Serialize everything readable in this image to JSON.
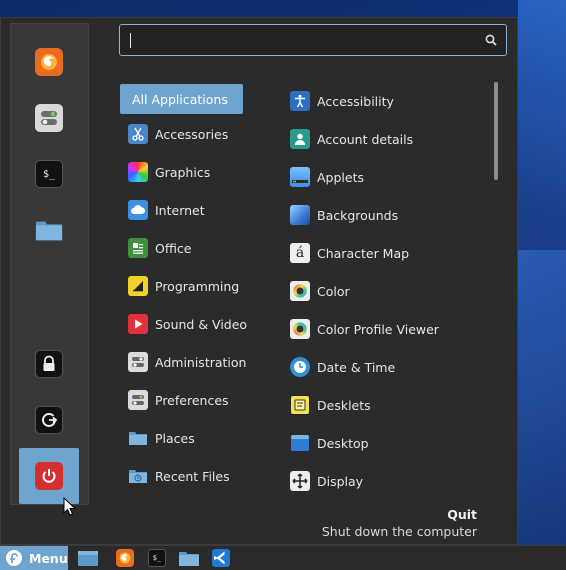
{
  "search": {
    "value": "",
    "placeholder": ""
  },
  "sidebar": {
    "favorites": [
      {
        "name": "firefox",
        "icon": "firefox-icon"
      },
      {
        "name": "settings",
        "icon": "toggle-settings-icon"
      },
      {
        "name": "terminal",
        "icon": "terminal-icon",
        "glyph": "$_"
      },
      {
        "name": "files",
        "icon": "folder-icon"
      }
    ],
    "session": [
      {
        "name": "lock-screen",
        "icon": "lock-icon"
      },
      {
        "name": "logout",
        "icon": "logout-icon"
      },
      {
        "name": "quit",
        "icon": "power-icon",
        "active": true
      }
    ]
  },
  "categories": [
    {
      "label": "All Applications",
      "selected": true
    },
    {
      "label": "Accessories",
      "icon": "scissors-icon"
    },
    {
      "label": "Graphics",
      "icon": "graphics-icon"
    },
    {
      "label": "Internet",
      "icon": "cloud-icon"
    },
    {
      "label": "Office",
      "icon": "office-icon"
    },
    {
      "label": "Programming",
      "icon": "programming-icon"
    },
    {
      "label": "Sound & Video",
      "icon": "play-icon"
    },
    {
      "label": "Administration",
      "icon": "admin-icon"
    },
    {
      "label": "Preferences",
      "icon": "preferences-icon"
    },
    {
      "label": "Places",
      "icon": "folder-icon"
    },
    {
      "label": "Recent Files",
      "icon": "recent-folder-icon"
    }
  ],
  "apps": [
    {
      "label": "Accessibility",
      "icon": "accessibility-icon"
    },
    {
      "label": "Account details",
      "icon": "account-icon"
    },
    {
      "label": "Applets",
      "icon": "applets-icon"
    },
    {
      "label": "Backgrounds",
      "icon": "backgrounds-icon"
    },
    {
      "label": "Character Map",
      "icon": "character-map-icon",
      "glyph": "á"
    },
    {
      "label": "Color",
      "icon": "color-icon"
    },
    {
      "label": "Color Profile Viewer",
      "icon": "color-profile-icon"
    },
    {
      "label": "Date & Time",
      "icon": "clock-icon"
    },
    {
      "label": "Desklets",
      "icon": "desklets-icon"
    },
    {
      "label": "Desktop",
      "icon": "desktop-icon"
    },
    {
      "label": "Display",
      "icon": "display-icon"
    }
  ],
  "info": {
    "title": "Quit",
    "description": "Shut down the computer"
  },
  "taskbar": {
    "menu_label": "Menu",
    "items": [
      {
        "name": "show-desktop",
        "icon": "desktop-icon"
      },
      {
        "name": "firefox",
        "icon": "firefox-icon"
      },
      {
        "name": "terminal",
        "icon": "terminal-icon",
        "glyph": "$_"
      },
      {
        "name": "files",
        "icon": "folder-icon"
      },
      {
        "name": "vscode",
        "icon": "vscode-icon"
      }
    ]
  },
  "colors": {
    "accent": "#6fa4cf",
    "menu_bg": "#2b2b2b",
    "sidebar_bg": "#383838",
    "search_border": "#8fb4d6",
    "power_red": "#d32f2f"
  }
}
